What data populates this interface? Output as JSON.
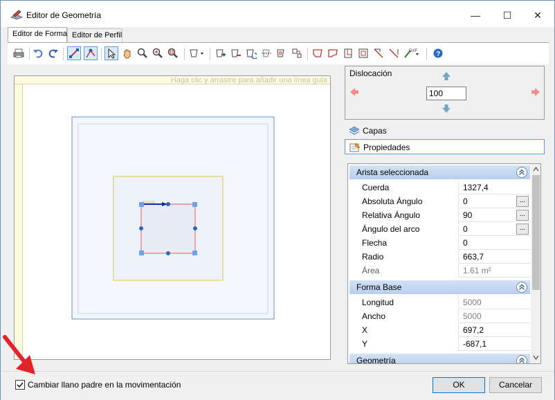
{
  "window": {
    "title": "Editor de Geometría",
    "minimize_glyph": "—",
    "maximize_glyph": "☐",
    "close_glyph": "✕"
  },
  "tabs": [
    {
      "label": "Editor de Forma",
      "active": true
    },
    {
      "label": "Editor de Perfil",
      "active": false
    }
  ],
  "toolbar": {
    "icons": [
      "print-icon",
      "undo-icon",
      "redo-icon",
      "edit-edge-icon",
      "edit-node-icon",
      "select-arrow-icon",
      "pan-hand-icon",
      "zoom-icon",
      "zoom-in-icon",
      "zoom-extents-icon",
      "shape-dropdown-icon",
      "add-node-icon",
      "remove-node-icon",
      "rotate-icon",
      "mirror-icon",
      "offset-icon",
      "align-icon",
      "chamfer-icon",
      "fillet-icon",
      "notch-icon",
      "inset-icon",
      "cut-icon",
      "cut-corner-icon",
      "dxf-import-icon",
      "help-icon"
    ]
  },
  "canvas": {
    "guide_hint": "Haga clic y arrastre para añadir una línea guía"
  },
  "displacement": {
    "label": "Dislocación",
    "value": "100"
  },
  "nav": {
    "layers": "Capas",
    "properties": "Propiedades"
  },
  "properties": {
    "section1": {
      "title": "Arista seleccionada",
      "rows": [
        {
          "key": "Cuerda",
          "value": "1327,4",
          "readonly": false,
          "button": false
        },
        {
          "key": "Absoluta Ángulo",
          "value": "0",
          "readonly": false,
          "button": true
        },
        {
          "key": "Relativa Ángulo",
          "value": "90",
          "readonly": false,
          "button": true
        },
        {
          "key": "Ángulo del arco",
          "value": "0",
          "readonly": false,
          "button": true
        },
        {
          "key": "Flecha",
          "value": "0",
          "readonly": false,
          "button": false
        },
        {
          "key": "Radio",
          "value": "663,7",
          "readonly": false,
          "button": false
        },
        {
          "key": "Área",
          "value": "1.61 m²",
          "readonly": true,
          "button": false
        }
      ]
    },
    "section2": {
      "title": "Forma Base",
      "rows": [
        {
          "key": "Longitud",
          "value": "5000",
          "readonly": true
        },
        {
          "key": "Ancho",
          "value": "5000",
          "readonly": true
        },
        {
          "key": "X",
          "value": "697,2",
          "readonly": false
        },
        {
          "key": "Y",
          "value": "-687,1",
          "readonly": false
        }
      ]
    },
    "section3": {
      "title": "Geometría"
    },
    "ellipsis": "..."
  },
  "footer": {
    "checkbox_label": "Cambiar llano padre en la movimentación",
    "checked": true,
    "ok": "OK",
    "cancel": "Cancelar"
  },
  "colors": {
    "accent": "#5a9de0",
    "shape_outer": "#6a8fc8",
    "shape_yellow": "#e6c547",
    "selection": "#e35b5b",
    "handle": "#6aa4ef",
    "node": "#2f66b3",
    "arrow_red": "#e3222a"
  }
}
